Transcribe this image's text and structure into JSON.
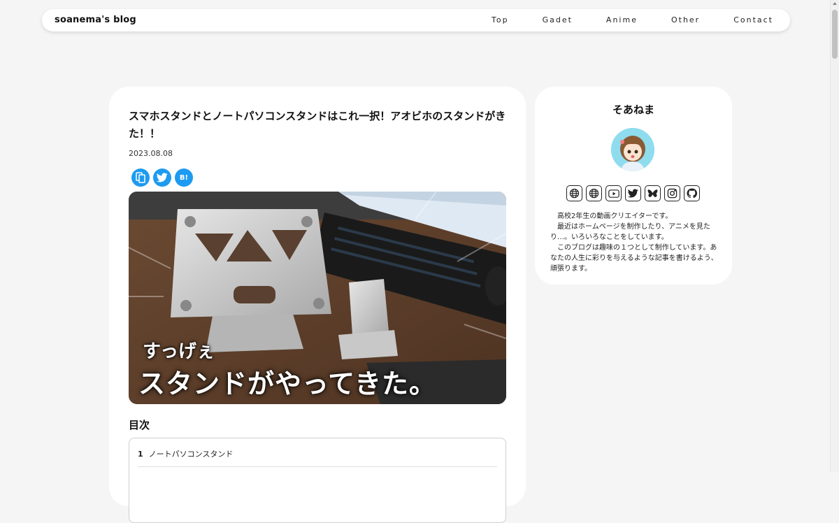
{
  "header": {
    "brand": "soanema's blog",
    "nav": [
      "Top",
      "Gadet",
      "Anime",
      "Other",
      "Contact"
    ]
  },
  "article": {
    "title": "スマホスタンドとノートパソコンスタンドはこれ一択！アオビホのスタンドがきた！！",
    "date": "2023.08.08",
    "share_icons": [
      "copy-icon",
      "twitter-icon",
      "hatena-bookmark-icon"
    ],
    "share_hatena_label": "B!",
    "hero": {
      "line1": "すっげぇ",
      "line2": "スタンドがやってきた。"
    },
    "toc": {
      "heading": "目次",
      "items": [
        {
          "num": "1",
          "label": "ノートパソコンスタンド"
        }
      ]
    }
  },
  "profile": {
    "name": "そあねま",
    "social_icons": [
      "globe-icon",
      "globe-icon",
      "youtube-icon",
      "twitter-icon",
      "bluesky-icon",
      "instagram-icon",
      "github-icon"
    ],
    "bio": [
      "高校2年生の動画クリエイターです。",
      "最近はホームページを制作したり、アニメを見たり…。いろいろなことをしています。",
      "このブログは趣味の１つとして制作しています。あなたの人生に彩りを与えるような記事を書けるよう、頑張ります。"
    ]
  },
  "colors": {
    "background": "#f5f5f5",
    "card": "#ffffff",
    "share_blue": "#1d9bf0"
  }
}
